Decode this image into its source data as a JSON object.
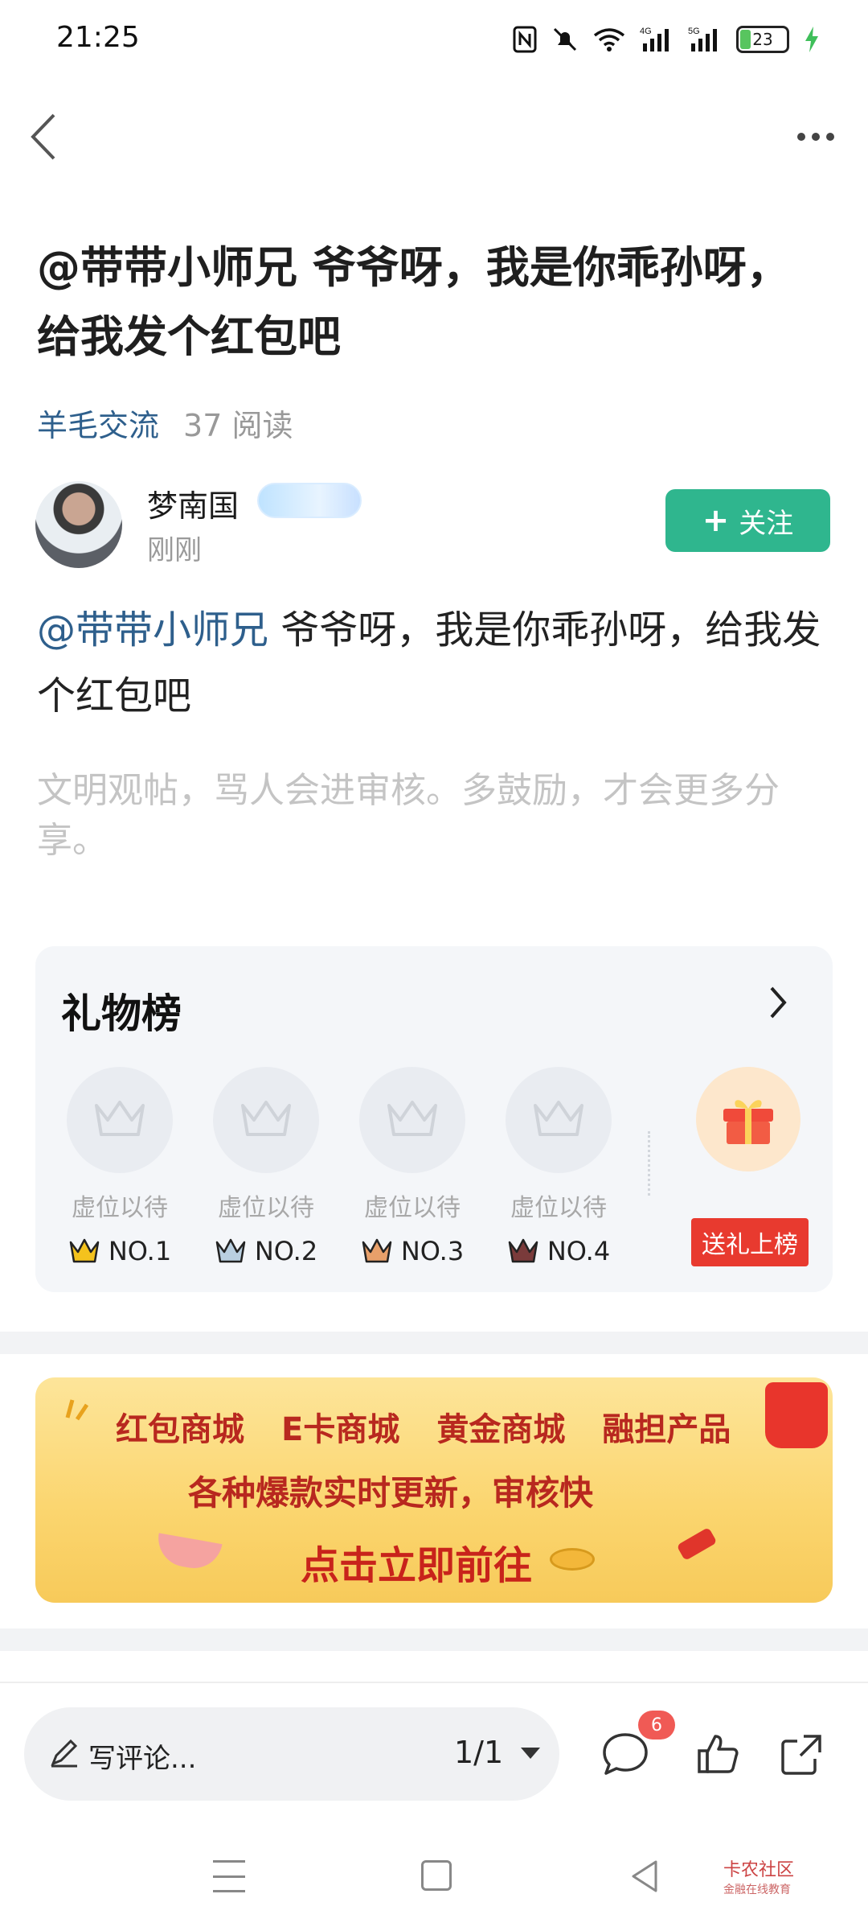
{
  "status_bar": {
    "time": "21:25",
    "battery": "23",
    "icons": [
      "nfc-icon",
      "mute-icon",
      "wifi-icon",
      "4g-signal-icon",
      "5g-signal-icon",
      "battery-icon",
      "charging-icon"
    ],
    "net1": "4G",
    "net2": "5G"
  },
  "post": {
    "title": "@带带小师兄 爷爷呀，我是你乖孙呀，给我发个红包吧",
    "board": "羊毛交流",
    "reads": "37 阅读",
    "author": {
      "name": "梦南国",
      "time": "刚刚",
      "follow_label": "关注"
    },
    "body_mention": "@带带小师兄",
    "body_text": " 爷爷呀，我是你乖孙呀，给我发个红包吧",
    "hint": "文明观帖，骂人会进审核。多鼓励，才会更多分享。"
  },
  "gift_board": {
    "title": "礼物榜",
    "slots": [
      {
        "label": "虚位以待",
        "rank": "NO.1"
      },
      {
        "label": "虚位以待",
        "rank": "NO.2"
      },
      {
        "label": "虚位以待",
        "rank": "NO.3"
      },
      {
        "label": "虚位以待",
        "rank": "NO.4"
      }
    ],
    "send_label": "送礼上榜"
  },
  "banner": {
    "items": [
      "红包商城",
      "E卡商城",
      "黄金商城",
      "融担产品"
    ],
    "line2": "各种爆款实时更新，审核快",
    "cta": "点击立即前往"
  },
  "bottom_bar": {
    "comment_placeholder": "写评论...",
    "page": "1/1",
    "comment_count": "6"
  },
  "watermark": {
    "title": "卡农社区",
    "subtitle": "金融在线教育"
  },
  "colors": {
    "accent_green": "#2fb68e",
    "link_blue": "#2e5f8c",
    "red": "#e83a2f"
  }
}
